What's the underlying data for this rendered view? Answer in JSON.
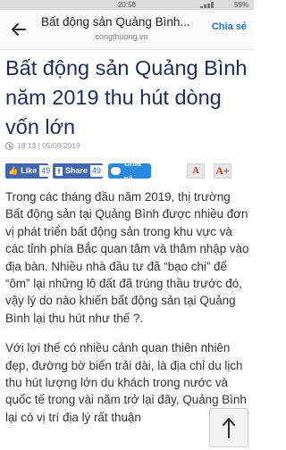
{
  "status_bar": {
    "time": "20:58",
    "battery": "59%"
  },
  "app_bar": {
    "title": "Bất động sản Quảng Bình...",
    "domain": "congthuong.vn",
    "share_label": "Chia sẻ"
  },
  "article": {
    "headline": "Bất động sản Quảng Bình năm 2019 thu hút dòng vốn lớn",
    "timestamp": "18:13 | 05/08/2019",
    "paragraphs": [
      "Trong các tháng đầu năm 2019, thị trường Bất động sản tại Quảng Bình được nhiều đơn vị phát triển bất động sản trong khu vực và các tỉnh phía Bắc quan tâm và thâm nhập vào địa bàn. Nhiều nhà đầu tư đã “bạo chi” để “ôm” lại những lô đất đã trúng thầu trước đó, vậy lý do nào khiến bất động sản tại Quảng Bình lại thu hút như thế ?.",
      "Với lợi thế có nhiều cảnh quan thiên nhiên đẹp, đường bờ biển trải dài, là địa chỉ du lịch thu hút lượng lớn du khách trong nước và quốc tế trong vài năm trở lại đây, Quảng Bình lại có vị trí địa lý rất thuận"
    ]
  },
  "social": {
    "like_label": "Like",
    "like_count": "49",
    "share_label": "Share",
    "share_count": "49",
    "zalo_label": "Chia sẻ",
    "font_decrease": "A",
    "font_increase": "A+"
  },
  "colors": {
    "headline": "#1c2d5a",
    "facebook": "#4267b2",
    "zalo": "#2a89e0",
    "link": "#1a73c9"
  }
}
